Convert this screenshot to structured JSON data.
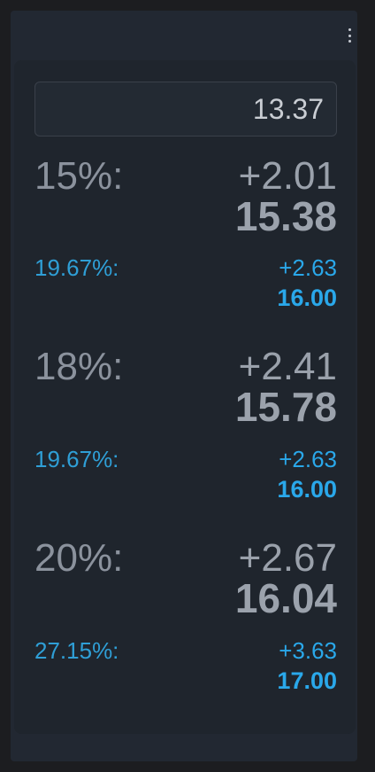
{
  "input": {
    "value": "13.37"
  },
  "rows": [
    {
      "main": {
        "percent": "15%:",
        "tip": "+2.01",
        "total": "15.38"
      },
      "rounded": {
        "percent": "19.67%:",
        "tip": "+2.63",
        "total": "16.00"
      }
    },
    {
      "main": {
        "percent": "18%:",
        "tip": "+2.41",
        "total": "15.78"
      },
      "rounded": {
        "percent": "19.67%:",
        "tip": "+2.63",
        "total": "16.00"
      }
    },
    {
      "main": {
        "percent": "20%:",
        "tip": "+2.67",
        "total": "16.04"
      },
      "rounded": {
        "percent": "27.15%:",
        "tip": "+3.63",
        "total": "17.00"
      }
    }
  ],
  "colors": {
    "main_text": "#9aa1ab",
    "rounded_text": "#2aa8ea",
    "panel": "#1f252d",
    "background": "#1c1d20"
  },
  "icons": {
    "menu": "more-vertical-icon"
  }
}
